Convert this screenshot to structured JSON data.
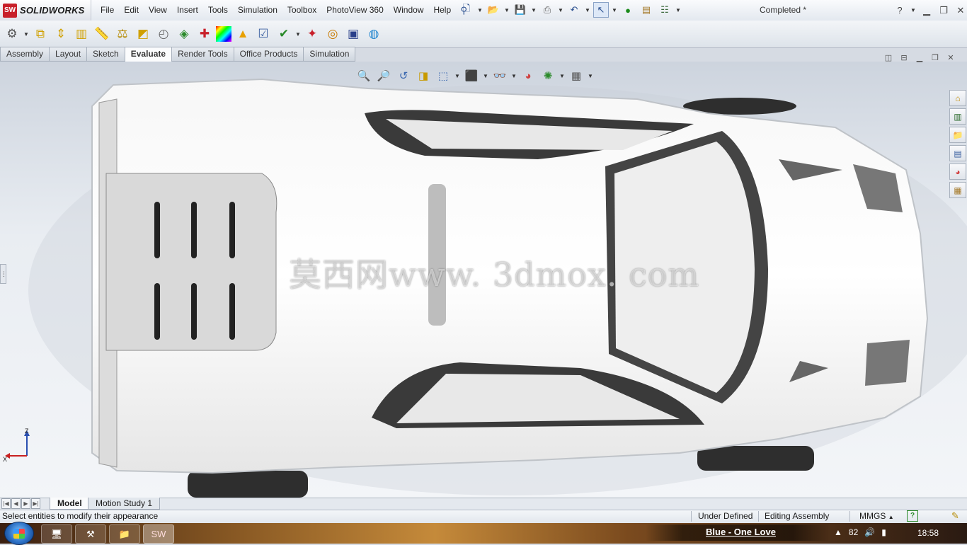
{
  "app": {
    "logo_mark": "SW",
    "logo_text": "SOLIDWORKS",
    "document_title": "Completed *"
  },
  "menu": [
    "File",
    "Edit",
    "View",
    "Insert",
    "Tools",
    "Simulation",
    "Toolbox",
    "PhotoView 360",
    "Window",
    "Help"
  ],
  "command_tabs": [
    {
      "label": "Assembly",
      "active": false
    },
    {
      "label": "Layout",
      "active": false
    },
    {
      "label": "Sketch",
      "active": false
    },
    {
      "label": "Evaluate",
      "active": true
    },
    {
      "label": "Render Tools",
      "active": false
    },
    {
      "label": "Office Products",
      "active": false
    },
    {
      "label": "Simulation",
      "active": false
    }
  ],
  "viewport": {
    "watermark": "莫西网www. 3dmox. com",
    "triad_z": "Z",
    "triad_x": "X"
  },
  "bottom_tabs": {
    "model": "Model",
    "motion_study": "Motion Study 1"
  },
  "status_bar": {
    "message": "Select entities to modify their appearance",
    "definition": "Under Defined",
    "mode": "Editing Assembly",
    "units": "MMGS",
    "units_caret": "▲",
    "help_icon": "?"
  },
  "taskbar": {
    "now_playing": "Blue - One Love",
    "volume_level": "82",
    "clock": "18:58"
  },
  "colors": {
    "accent": "#c8202a",
    "highlight_blue": "#3b68b0"
  }
}
